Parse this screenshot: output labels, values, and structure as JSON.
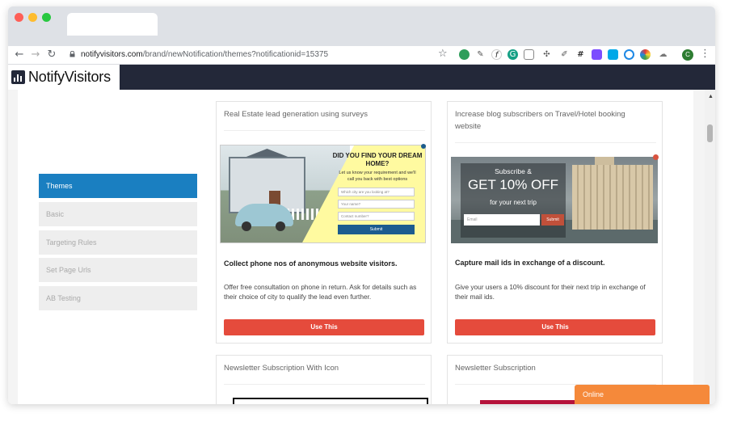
{
  "browser": {
    "url_host": "notifyvisitors.com",
    "url_path": "/brand/newNotification/themes?notificationid=15375",
    "avatar_letter": "C"
  },
  "app": {
    "logo_text": "NotifyVisitors"
  },
  "sidebar": {
    "items": [
      {
        "label": "Themes",
        "active": true
      },
      {
        "label": "Basic",
        "active": false
      },
      {
        "label": "Targeting Rules",
        "active": false
      },
      {
        "label": "Set Page Urls",
        "active": false
      },
      {
        "label": "AB Testing",
        "active": false
      }
    ]
  },
  "cards": [
    {
      "title": "Real Estate lead generation using surveys",
      "heading": "Collect phone nos of anonymous website visitors.",
      "description": "Offer free consultation on phone in return. Ask for details such as their choice of city to qualify the lead even further.",
      "button": "Use This",
      "preview": {
        "title": "DID YOU FIND YOUR DREAM HOME?",
        "subtitle": "Let us know your requirement and we'll call you back with best options",
        "fields": [
          "Which city are you looking at?",
          "Your name?",
          "Contact number?"
        ],
        "submit": "Submit"
      }
    },
    {
      "title": "Increase blog subscribers on Travel/Hotel booking website",
      "heading": "Capture mail ids in exchange of a discount.",
      "description": "Give your users a 10% discount for their next trip in exchange of their mail ids.",
      "button": "Use This",
      "preview": {
        "line1": "Subscribe &",
        "line2": "GET 10% OFF",
        "line3": "for your next trip",
        "email_placeholder": "Email",
        "submit": "Submit"
      }
    },
    {
      "title": "Newsletter Subscription With Icon"
    },
    {
      "title": "Newsletter Subscription"
    }
  ],
  "chat": {
    "label": "Online"
  },
  "colors": {
    "accent": "#1a7fc1",
    "button": "#e54b3c",
    "appbar": "#232839",
    "chat": "#f5893a"
  }
}
